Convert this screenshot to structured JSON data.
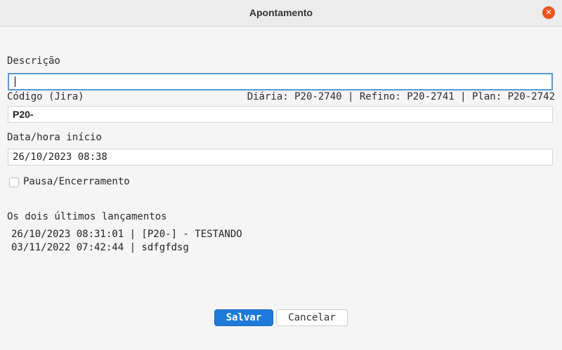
{
  "window": {
    "title": "Apontamento",
    "close_icon": "close-icon"
  },
  "form": {
    "descricao": {
      "label": "Descrição",
      "value": ""
    },
    "codigo": {
      "label": "Código (Jira)",
      "hint": "Diária: P20-2740 | Refino: P20-2741 | Plan: P20-2742",
      "value": "P20-"
    },
    "data_hora": {
      "label": "Data/hora início",
      "value": "26/10/2023 08:38"
    },
    "pausa": {
      "label": "Pausa/Encerramento",
      "checked": false
    }
  },
  "history": {
    "label": "Os dois últimos lançamentos",
    "items": [
      "26/10/2023 08:31:01 | [P20-] - TESTANDO",
      "03/11/2022 07:42:44 | sdfgfdsg"
    ]
  },
  "buttons": {
    "save": "Salvar",
    "cancel": "Cancelar"
  },
  "colors": {
    "accent": "#1e7ad8",
    "close": "#e95420",
    "focus": "#5b97d6"
  }
}
